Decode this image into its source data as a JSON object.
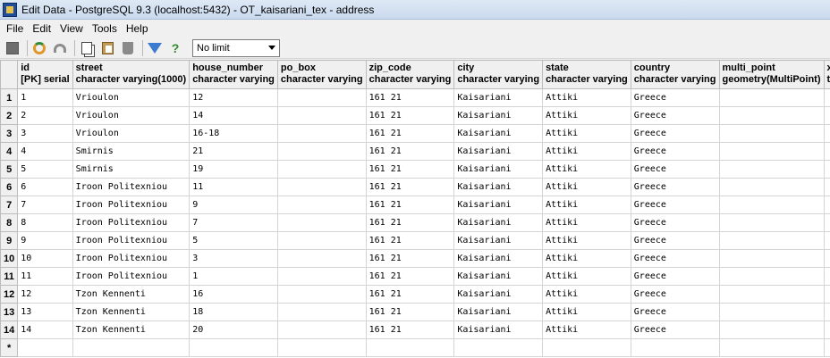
{
  "window": {
    "title": "Edit Data - PostgreSQL 9.3 (localhost:5432) - OT_kaisariani_tex - address"
  },
  "menu": [
    "File",
    "Edit",
    "View",
    "Tools",
    "Help"
  ],
  "toolbar": {
    "limit_value": "No limit"
  },
  "columns": [
    {
      "name": "id",
      "type": "[PK] serial"
    },
    {
      "name": "street",
      "type": "character varying(1000)"
    },
    {
      "name": "house_number",
      "type": "character varying"
    },
    {
      "name": "po_box",
      "type": "character varying"
    },
    {
      "name": "zip_code",
      "type": "character varying"
    },
    {
      "name": "city",
      "type": "character varying"
    },
    {
      "name": "state",
      "type": "character varying"
    },
    {
      "name": "country",
      "type": "character varying"
    },
    {
      "name": "multi_point",
      "type": "geometry(MultiPoint)"
    },
    {
      "name": "xal_source",
      "type": "text"
    }
  ],
  "rows": [
    {
      "n": "1",
      "cells": [
        "1",
        "Vrioulon",
        "12",
        "",
        "161 21",
        "Kaisariani",
        "Attiki",
        "Greece",
        "",
        ""
      ]
    },
    {
      "n": "2",
      "cells": [
        "2",
        "Vrioulon",
        "14",
        "",
        "161 21",
        "Kaisariani",
        "Attiki",
        "Greece",
        "",
        ""
      ]
    },
    {
      "n": "3",
      "cells": [
        "3",
        "Vrioulon",
        "16-18",
        "",
        "161 21",
        "Kaisariani",
        "Attiki",
        "Greece",
        "",
        ""
      ]
    },
    {
      "n": "4",
      "cells": [
        "4",
        "Smirnis",
        "21",
        "",
        "161 21",
        "Kaisariani",
        "Attiki",
        "Greece",
        "",
        ""
      ]
    },
    {
      "n": "5",
      "cells": [
        "5",
        "Smirnis",
        "19",
        "",
        "161 21",
        "Kaisariani",
        "Attiki",
        "Greece",
        "",
        ""
      ]
    },
    {
      "n": "6",
      "cells": [
        "6",
        "Iroon Politexniou",
        "11",
        "",
        "161 21",
        "Kaisariani",
        "Attiki",
        "Greece",
        "",
        ""
      ]
    },
    {
      "n": "7",
      "cells": [
        "7",
        "Iroon Politexniou",
        "9",
        "",
        "161 21",
        "Kaisariani",
        "Attiki",
        "Greece",
        "",
        ""
      ]
    },
    {
      "n": "8",
      "cells": [
        "8",
        "Iroon Politexniou",
        "7",
        "",
        "161 21",
        "Kaisariani",
        "Attiki",
        "Greece",
        "",
        ""
      ]
    },
    {
      "n": "9",
      "cells": [
        "9",
        "Iroon Politexniou",
        "5",
        "",
        "161 21",
        "Kaisariani",
        "Attiki",
        "Greece",
        "",
        ""
      ]
    },
    {
      "n": "10",
      "cells": [
        "10",
        "Iroon Politexniou",
        "3",
        "",
        "161 21",
        "Kaisariani",
        "Attiki",
        "Greece",
        "",
        ""
      ]
    },
    {
      "n": "11",
      "cells": [
        "11",
        "Iroon Politexniou",
        "1",
        "",
        "161 21",
        "Kaisariani",
        "Attiki",
        "Greece",
        "",
        ""
      ]
    },
    {
      "n": "12",
      "cells": [
        "12",
        "Tzon Kennenti",
        "16",
        "",
        "161 21",
        "Kaisariani",
        "Attiki",
        "Greece",
        "",
        ""
      ]
    },
    {
      "n": "13",
      "cells": [
        "13",
        "Tzon Kennenti",
        "18",
        "",
        "161 21",
        "Kaisariani",
        "Attiki",
        "Greece",
        "",
        ""
      ]
    },
    {
      "n": "14",
      "cells": [
        "14",
        "Tzon Kennenti",
        "20",
        "",
        "161 21",
        "Kaisariani",
        "Attiki",
        "Greece",
        "",
        ""
      ]
    },
    {
      "n": "*",
      "cells": [
        "",
        "",
        "",
        "",
        "",
        "",
        "",
        "",
        "",
        ""
      ]
    }
  ]
}
